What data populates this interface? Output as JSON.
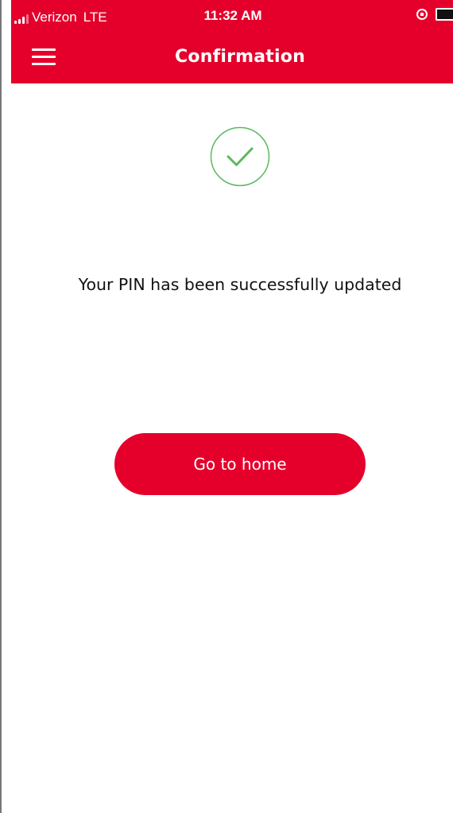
{
  "status_bar": {
    "carrier": "Verizon",
    "network": "LTE",
    "time": "11:32 AM"
  },
  "header": {
    "title": "Confirmation"
  },
  "confirmation": {
    "message": "Your PIN has been successfully updated",
    "icon": "check-circle-icon"
  },
  "actions": {
    "home_label": "Go to home"
  },
  "colors": {
    "brand": "#e4002b",
    "success": "#5cb85c",
    "text": "#111111",
    "background": "#ffffff"
  }
}
